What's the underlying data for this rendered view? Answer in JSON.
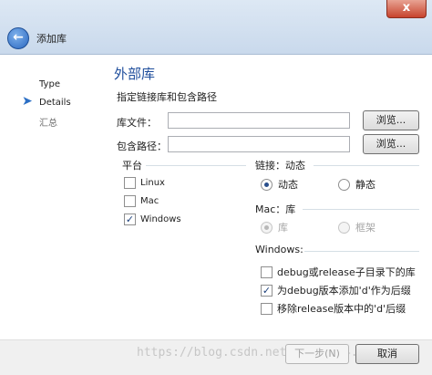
{
  "window": {
    "title": "添加库",
    "close": "x"
  },
  "steps": [
    {
      "label": "Type"
    },
    {
      "label": "Details"
    },
    {
      "label": "汇总"
    }
  ],
  "heading": "外部库",
  "description": "指定链接库和包含路径",
  "library_file": {
    "label": "库文件：",
    "value": "",
    "browse": "浏览..."
  },
  "include_path": {
    "label": "包含路径：",
    "value": "",
    "browse": "浏览..."
  },
  "platform": {
    "title": "平台",
    "options": [
      {
        "label": "Linux",
        "checked": false
      },
      {
        "label": "Mac",
        "checked": false
      },
      {
        "label": "Windows",
        "checked": true
      }
    ]
  },
  "linkage": {
    "title": "链接：动态",
    "options": [
      {
        "label": "动态",
        "selected": true
      },
      {
        "label": "静态",
        "selected": false
      }
    ]
  },
  "mac": {
    "title": "Mac：库",
    "options": [
      {
        "label": "库",
        "selected": true
      },
      {
        "label": "框架",
        "selected": false
      }
    ]
  },
  "windows": {
    "title": "Windows:",
    "options": [
      {
        "label": "debug或release子目录下的库",
        "checked": false
      },
      {
        "label": "为debug版本添加'd'作为后缀",
        "checked": true
      },
      {
        "label": "移除release版本中的'd'后缀",
        "checked": false
      }
    ]
  },
  "footer": {
    "next": "下一步(N)",
    "cancel": "取消",
    "watermark": "https://blog.csdn.net/weixin_4...97"
  }
}
